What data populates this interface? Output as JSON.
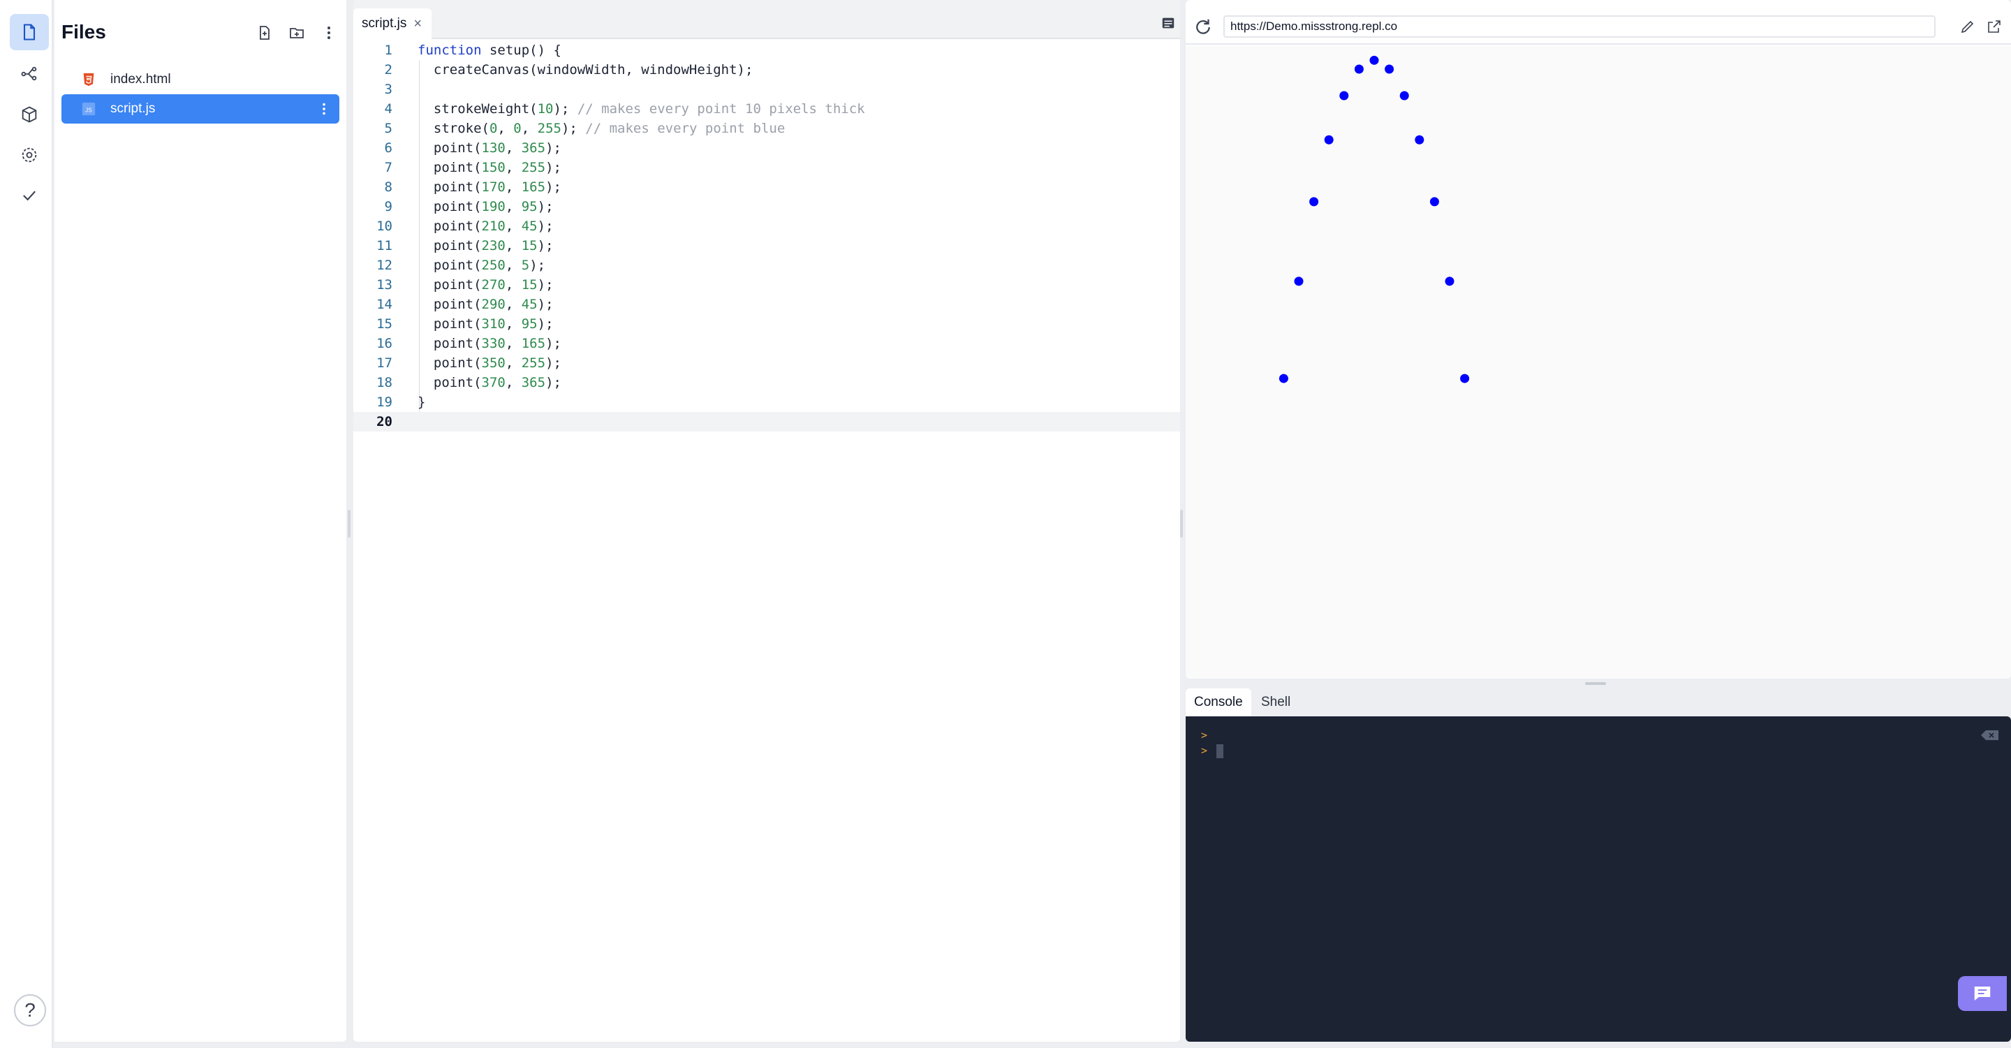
{
  "files_panel": {
    "title": "Files",
    "items": [
      {
        "name": "index.html",
        "icon": "html5-icon",
        "selected": false
      },
      {
        "name": "script.js",
        "icon": "js-file-icon",
        "selected": true
      }
    ]
  },
  "activity_bar": {
    "items": [
      "files-icon",
      "git-branch-icon",
      "package-icon",
      "settings-icon",
      "check-icon"
    ],
    "help_label": "?"
  },
  "editor": {
    "tab_label": "script.js",
    "close_glyph": "×",
    "current_line": 20,
    "lines": [
      "function setup() {",
      "  createCanvas(windowWidth, windowHeight);",
      "",
      "  strokeWeight(10); // makes every point 10 pixels thick",
      "  stroke(0, 0, 255); // makes every point blue",
      "  point(130, 365);",
      "  point(150, 255);",
      "  point(170, 165);",
      "  point(190, 95);",
      "  point(210, 45);",
      "  point(230, 15);",
      "  point(250, 5);",
      "  point(270, 15);",
      "  point(290, 45);",
      "  point(310, 95);",
      "  point(330, 165);",
      "  point(350, 255);",
      "  point(370, 365);",
      "}",
      ""
    ]
  },
  "preview": {
    "url": "https://Demo.missstrong.repl.co",
    "point_color": "#0000ff",
    "points": [
      [
        130,
        365
      ],
      [
        150,
        255
      ],
      [
        170,
        165
      ],
      [
        190,
        95
      ],
      [
        210,
        45
      ],
      [
        230,
        15
      ],
      [
        250,
        5
      ],
      [
        270,
        15
      ],
      [
        290,
        45
      ],
      [
        310,
        95
      ],
      [
        330,
        165
      ],
      [
        350,
        255
      ],
      [
        370,
        365
      ]
    ]
  },
  "console": {
    "tabs": [
      "Console",
      "Shell"
    ],
    "active_tab": "Console",
    "prompts": [
      ">",
      ">"
    ]
  },
  "colors": {
    "accent": "#3a84f4",
    "console_bg": "#1c2333",
    "chat_button": "#8b7df2"
  }
}
